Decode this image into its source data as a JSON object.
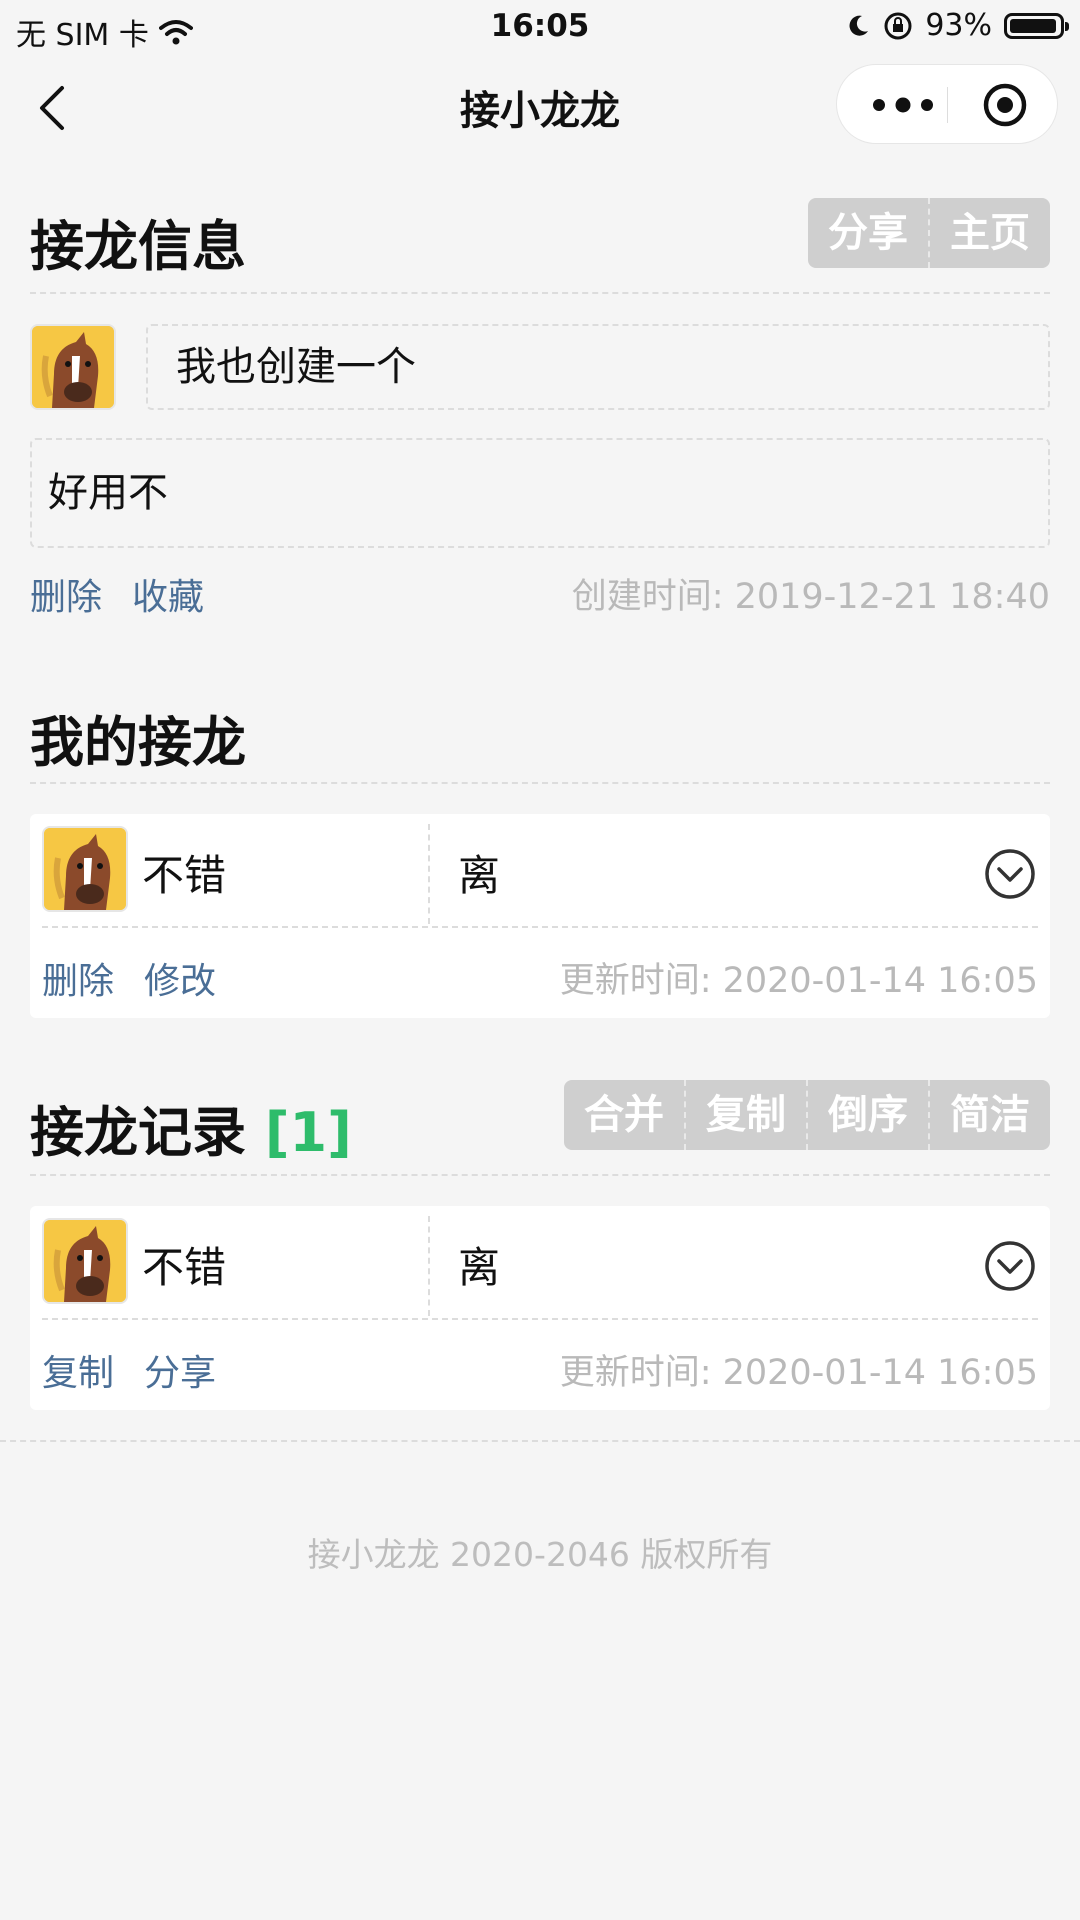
{
  "status_bar": {
    "carrier": "无 SIM 卡",
    "time": "16:05",
    "battery": "93%",
    "battery_level": 0.93,
    "icons": [
      "wifi-icon",
      "moon-icon",
      "orientation-lock-icon",
      "battery-icon"
    ]
  },
  "nav": {
    "title": "接小龙龙",
    "icons": [
      "back-chevron-icon",
      "more-dots-icon",
      "target-circle-icon"
    ]
  },
  "info_section": {
    "heading": "接龙信息",
    "actions": [
      "分享",
      "主页"
    ],
    "title_value": "我也创建一个",
    "description_value": "好用不",
    "links": [
      "删除",
      "收藏"
    ],
    "created_time": "创建时间: 2019-12-21 18:40"
  },
  "my_section": {
    "heading": "我的接龙",
    "entry": {
      "name": "不错",
      "content": "离",
      "links": [
        "删除",
        "修改"
      ],
      "updated_time": "更新时间: 2020-01-14 16:05"
    }
  },
  "records_section": {
    "heading": "接龙记录",
    "count": "[1]",
    "actions": [
      "合并",
      "复制",
      "倒序",
      "简洁"
    ],
    "entry": {
      "name": "不错",
      "content": "离",
      "links": [
        "复制",
        "分享"
      ],
      "updated_time": "更新时间: 2020-01-14 16:05"
    }
  },
  "footer": "接小龙龙 2020-2046 版权所有",
  "colors": {
    "background": "#f5f5f5",
    "link": "#4a6e96",
    "meta": "#b9b9b9",
    "button_group": "#cfcfcf",
    "count_green": "#2ebc6b",
    "avatar_yellow": "#f6c744"
  }
}
